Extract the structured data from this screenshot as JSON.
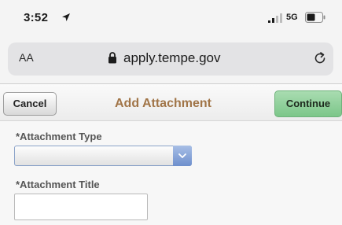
{
  "status_bar": {
    "time": "3:52",
    "network": "5G",
    "icons": [
      "location-icon",
      "signal-icon",
      "battery-icon"
    ]
  },
  "address_bar": {
    "reader_label": "AA",
    "url": "apply.tempe.gov",
    "icons": [
      "lock-icon",
      "reload-icon"
    ]
  },
  "toolbar": {
    "cancel_label": "Cancel",
    "title": "Add Attachment",
    "continue_label": "Continue"
  },
  "form": {
    "attachment_type": {
      "label": "*Attachment Type",
      "selected_value": ""
    },
    "attachment_title": {
      "label": "*Attachment Title",
      "value": "",
      "placeholder": ""
    }
  },
  "colors": {
    "title_brown": "#a17548",
    "continue_green": "#7cc689",
    "select_blue": "#6e8fcd"
  }
}
